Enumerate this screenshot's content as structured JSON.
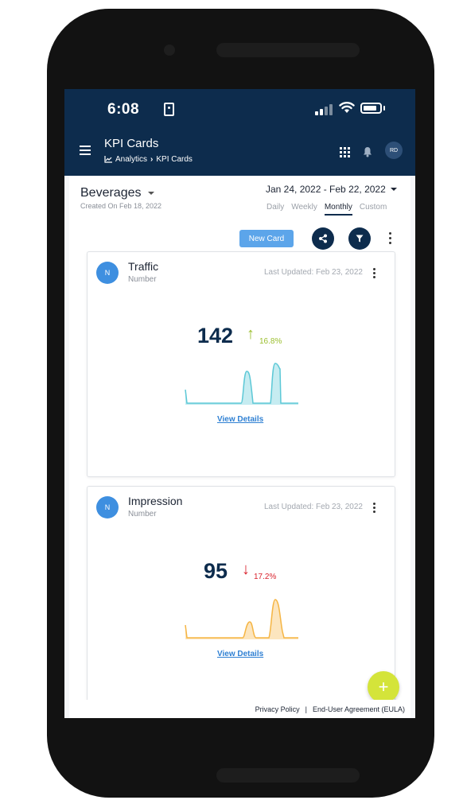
{
  "status_bar": {
    "time": "6:08"
  },
  "app_bar": {
    "title": "KPI Cards",
    "breadcrumb": {
      "section": "Analytics",
      "page": "KPI Cards"
    },
    "user_initials": "RD"
  },
  "dashboard": {
    "name": "Beverages",
    "created": "Created On Feb 18, 2022",
    "date_range": "Jan 24, 2022 - Feb 22, 2022",
    "periods": [
      "Daily",
      "Weekly",
      "Monthly",
      "Custom"
    ],
    "selected_period": "Monthly"
  },
  "toolbar": {
    "new_card_label": "New Card"
  },
  "cards": [
    {
      "badge": "N",
      "title": "Traffic",
      "subtitle": "Number",
      "updated": "Last Updated: Feb 23, 2022",
      "value": "142",
      "arrow": "↑",
      "change": "16.8%",
      "trend": "up",
      "color": "#5cc8d6",
      "link": "View Details"
    },
    {
      "badge": "N",
      "title": "Impression",
      "subtitle": "Number",
      "updated": "Last Updated: Feb 23, 2022",
      "value": "95",
      "arrow": "↓",
      "change": "17.2%",
      "trend": "down",
      "color": "#f5b544",
      "link": "View Details"
    }
  ],
  "fab": {
    "label": "+"
  },
  "footer": {
    "privacy": "Privacy Policy",
    "separator": "|",
    "eula": "End-User Agreement (EULA)"
  },
  "colors": {
    "primary": "#0d2c4d",
    "accent": "#5ca5ea",
    "up": "#9bbf2e",
    "down": "#d9232e",
    "fab": "#d4e43a"
  },
  "icons": [
    "menu-icon",
    "chart-icon",
    "chevron-right-icon",
    "apps-grid-icon",
    "bell-icon",
    "share-icon",
    "filter-icon",
    "more-vert-icon",
    "add-icon",
    "wifi-icon",
    "battery-icon",
    "signal-icon"
  ]
}
